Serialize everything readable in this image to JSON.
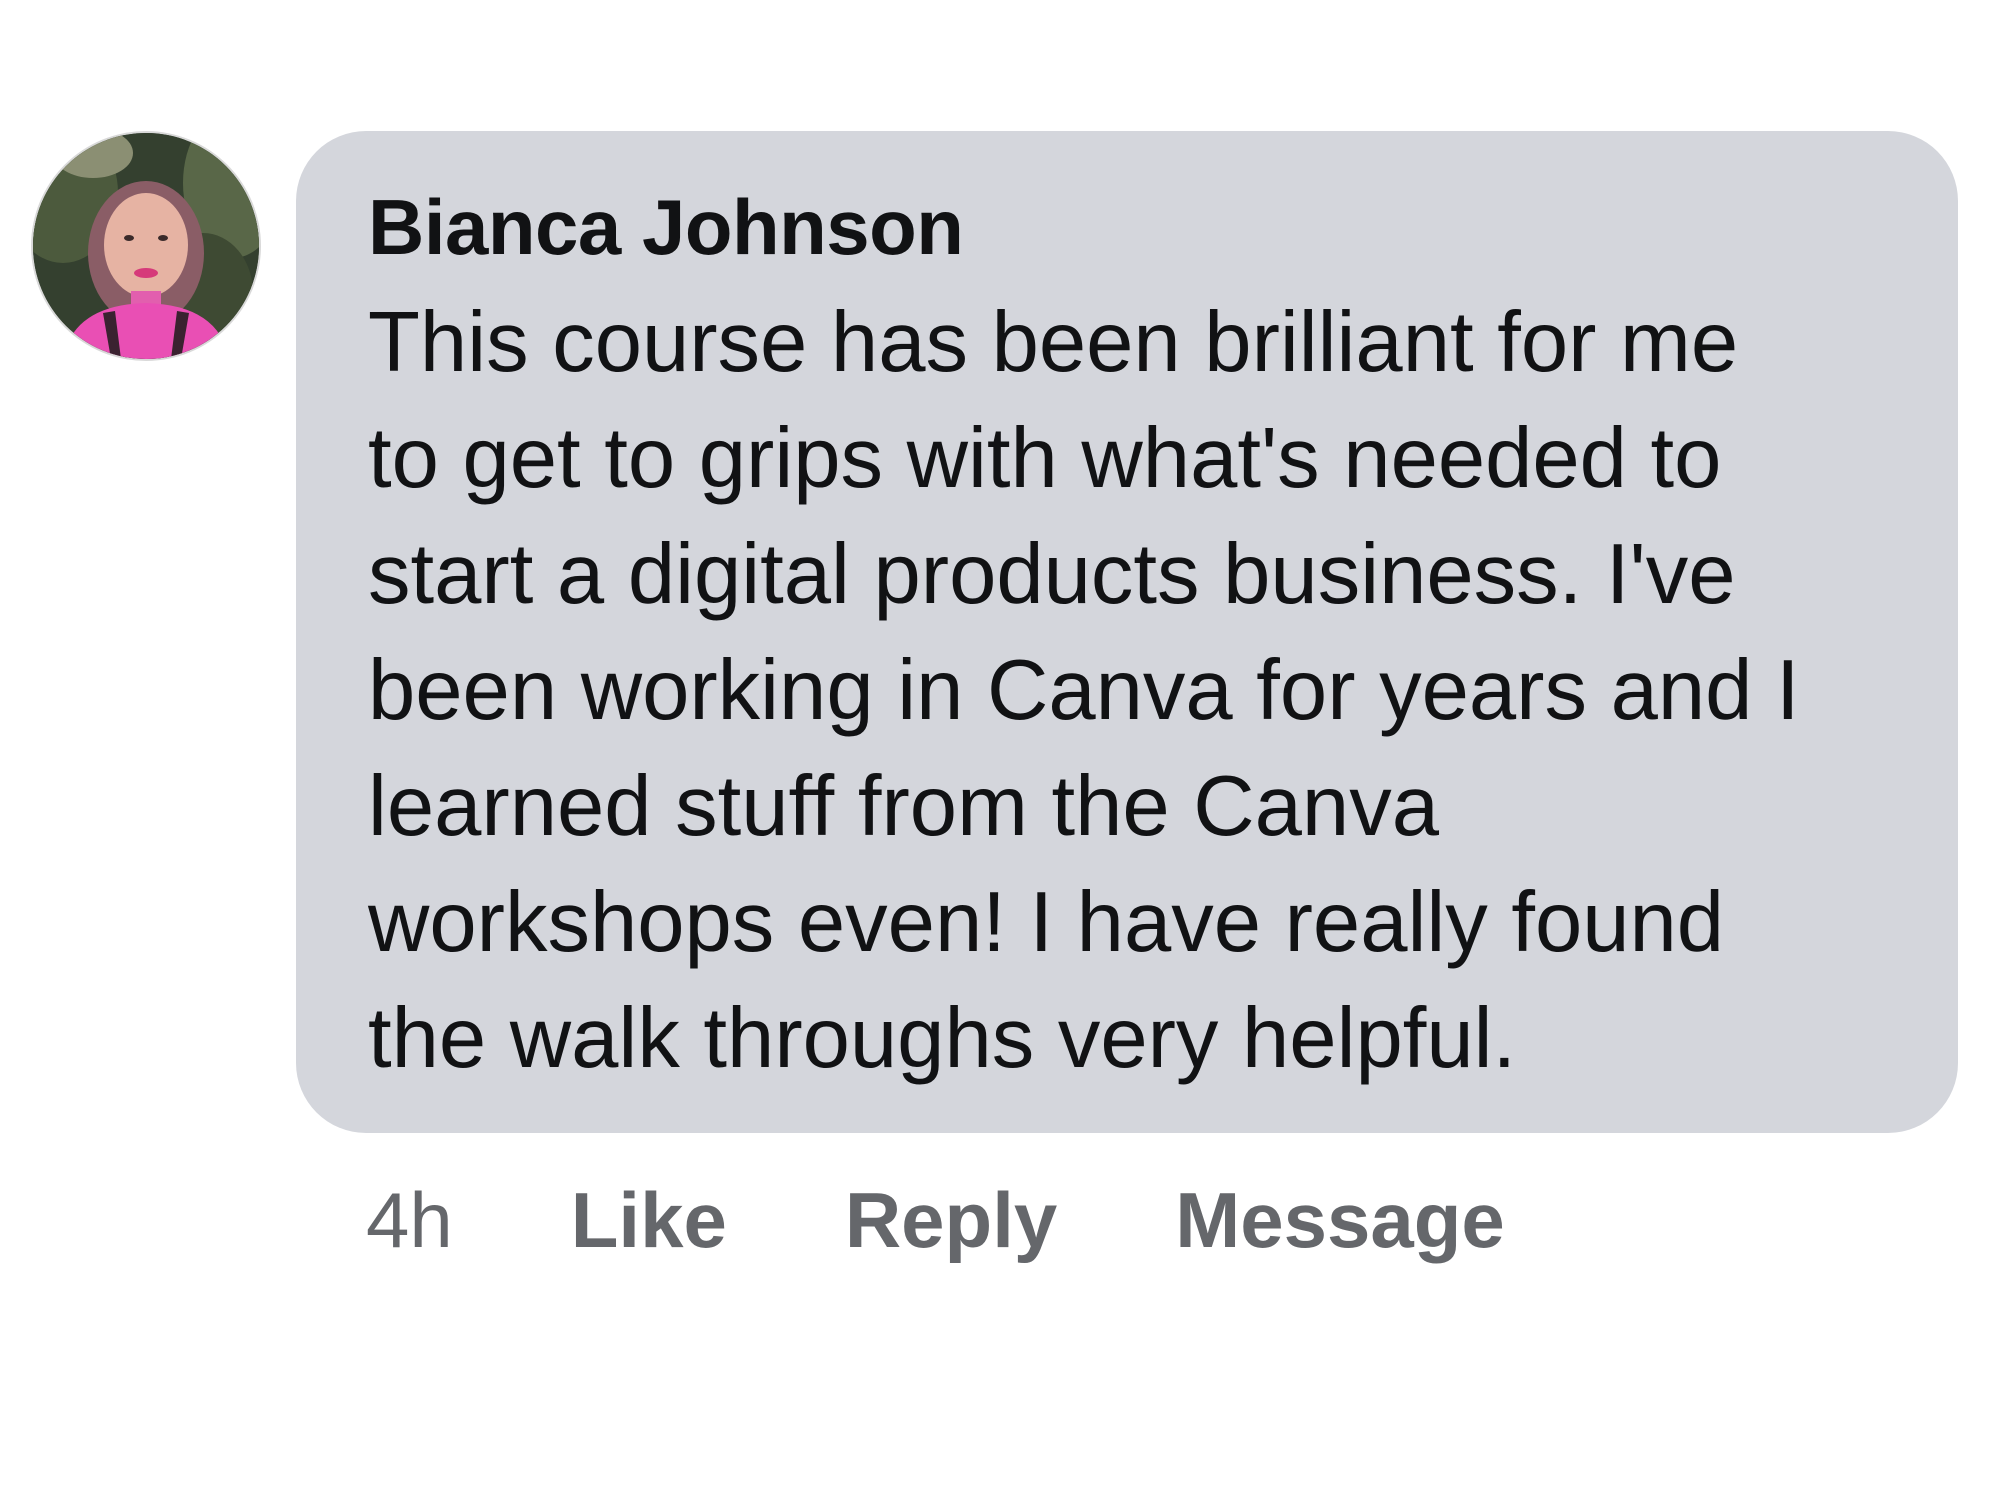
{
  "comment": {
    "author": "Bianca Johnson",
    "body_lines": [
      "This course has been brilliant for me",
      "to get to grips with what's needed to",
      "start a digital products business. I've",
      "been working in Canva for years and I",
      "learned stuff from the Canva",
      "workshops even! I have really found",
      "the walk throughs very helpful."
    ],
    "timestamp": "4h",
    "actions": {
      "like": "Like",
      "reply": "Reply",
      "message": "Message"
    }
  },
  "colors": {
    "bubble_background": "#d4d6dc",
    "text": "#111214",
    "meta_text": "#65676b",
    "avatar_shirt": "#e94fb4"
  }
}
